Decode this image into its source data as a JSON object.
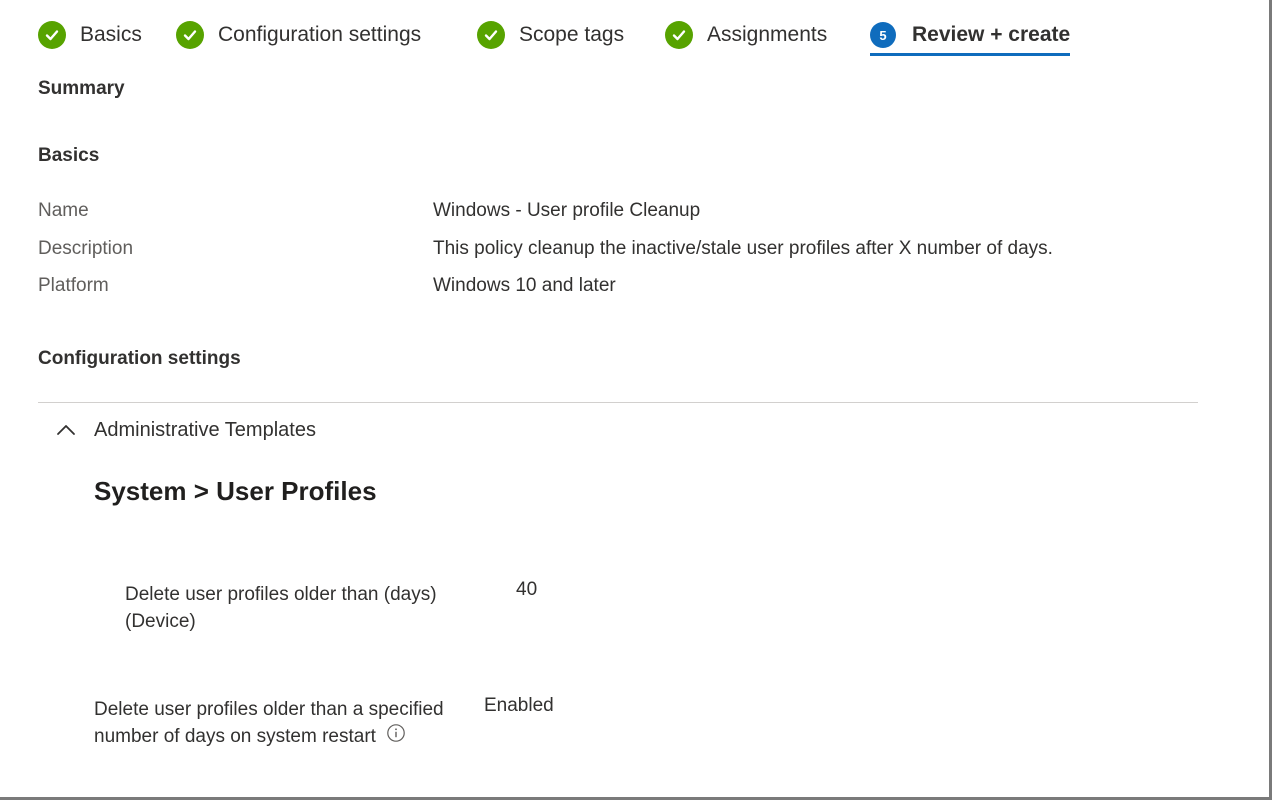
{
  "wizard": {
    "steps": [
      {
        "label": "Basics",
        "state": "complete"
      },
      {
        "label": "Configuration settings",
        "state": "complete"
      },
      {
        "label": "Scope tags",
        "state": "complete"
      },
      {
        "label": "Assignments",
        "state": "complete"
      },
      {
        "label": "Review + create",
        "state": "active",
        "number": "5"
      }
    ]
  },
  "summary": {
    "title": "Summary"
  },
  "basics": {
    "title": "Basics",
    "rows": [
      {
        "key": "Name",
        "value": "Windows - User profile Cleanup"
      },
      {
        "key": "Description",
        "value": "This policy cleanup the inactive/stale user profiles after X number of days."
      },
      {
        "key": "Platform",
        "value": "Windows 10 and later"
      }
    ]
  },
  "config": {
    "title": "Configuration settings",
    "accordion_label": "Administrative Templates",
    "group_title": "System > User Profiles",
    "settings": [
      {
        "label_line1": "Delete user profiles older than (days)",
        "label_line2": "(Device)",
        "value": "40"
      },
      {
        "label_line1": "Delete user profiles older than a specified",
        "label_line2": "number of days on system restart",
        "value": "Enabled"
      }
    ]
  },
  "colors": {
    "complete": "#57a300",
    "active": "#0f6cbd"
  },
  "icons": {
    "complete": "check-icon",
    "accordion": "chevron-up-icon",
    "info": "info-icon"
  }
}
